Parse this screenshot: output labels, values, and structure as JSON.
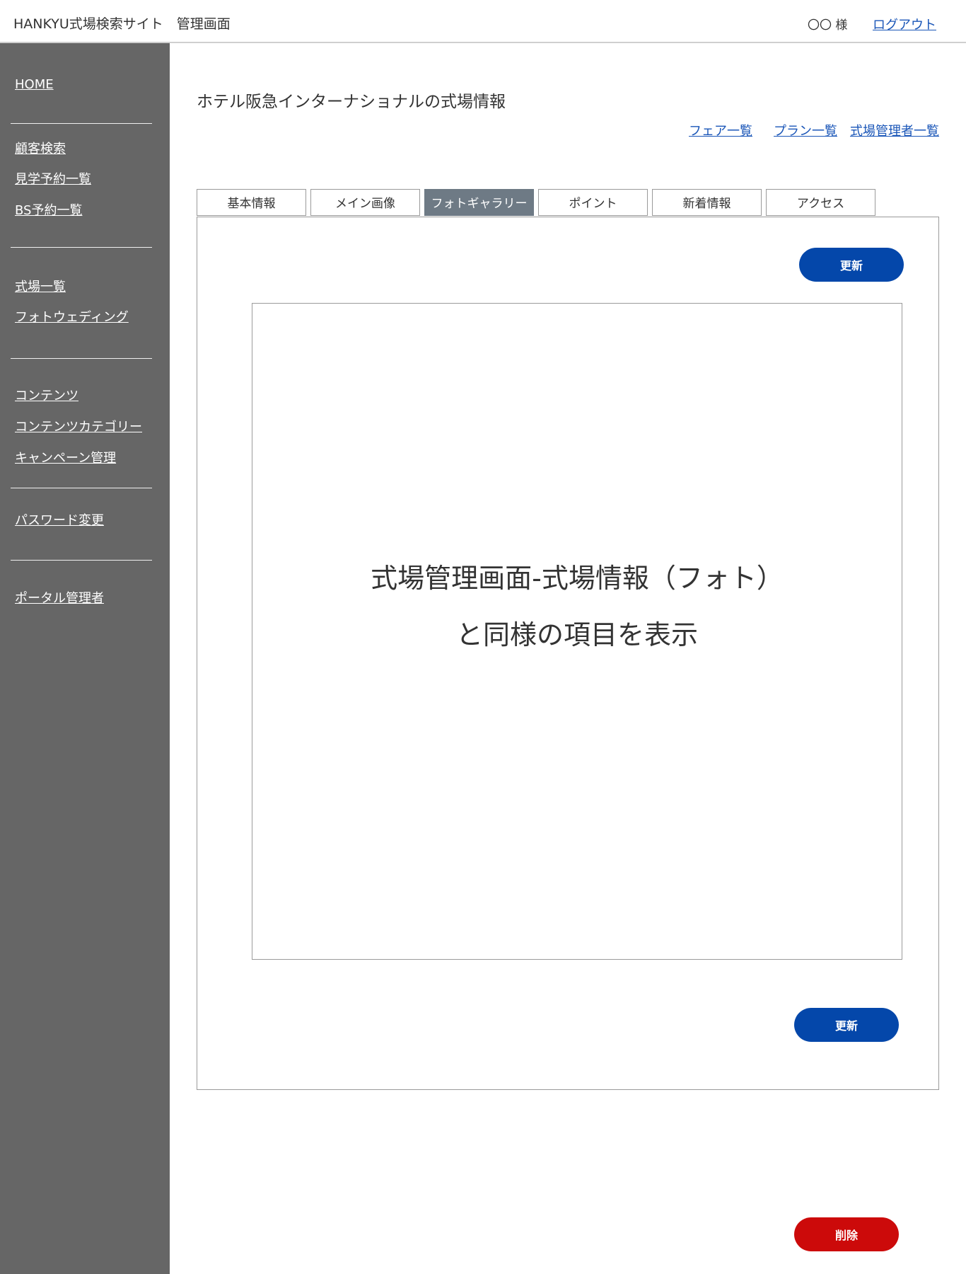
{
  "header": {
    "app_title": "HANKYU式場検索サイト　管理画面",
    "user_label": "〇〇 様",
    "logout_label": "ログアウト"
  },
  "sidebar": {
    "groups": [
      {
        "items": [
          {
            "label": "HOME"
          }
        ]
      },
      {
        "items": [
          {
            "label": "顧客検索"
          },
          {
            "label": "見学予約一覧"
          },
          {
            "label": "BS予約一覧"
          }
        ]
      },
      {
        "items": [
          {
            "label": "式場一覧"
          },
          {
            "label": "フォトウェディング"
          }
        ]
      },
      {
        "items": [
          {
            "label": "コンテンツ"
          },
          {
            "label": "コンテンツカテゴリー"
          },
          {
            "label": "キャンペーン管理"
          }
        ]
      },
      {
        "items": [
          {
            "label": "パスワード変更"
          }
        ]
      },
      {
        "items": [
          {
            "label": "ポータル管理者"
          }
        ]
      }
    ]
  },
  "main": {
    "title": "ホテル阪急インターナショナルの式場情報",
    "links": [
      {
        "label": "フェア一覧"
      },
      {
        "label": "プラン一覧"
      },
      {
        "label": "式場管理者一覧"
      }
    ],
    "tabs": [
      {
        "label": "基本情報"
      },
      {
        "label": "メイン画像"
      },
      {
        "label": "フォトギャラリー",
        "active": true
      },
      {
        "label": "ポイント"
      },
      {
        "label": "新着情報"
      },
      {
        "label": "アクセス"
      }
    ],
    "update_button_top": "更新",
    "update_button_bottom": "更新",
    "delete_button": "削除",
    "placeholder": {
      "line1": "式場管理画面-式場情報（フォト）",
      "line2": "と同様の項目を表示"
    }
  },
  "colors": {
    "sidebar_bg": "#666666",
    "active_tab_bg": "#6e7a85",
    "link_blue": "#1a56b8",
    "primary_button": "#0447aa",
    "danger_button": "#cc0a0a"
  },
  "icons": []
}
